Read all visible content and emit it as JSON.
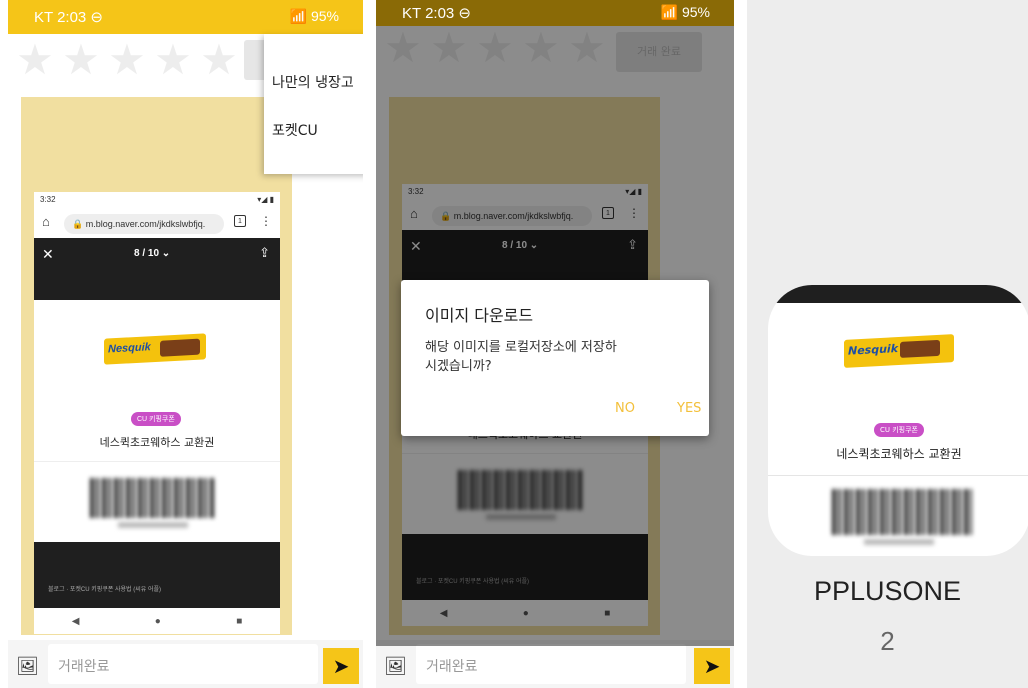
{
  "screen1": {
    "status": {
      "time": "KT 2:03 ⊖",
      "right": "📶 95%"
    },
    "stars": [
      "★",
      "★",
      "★",
      "★",
      "★"
    ],
    "menu": [
      "나만의 냉장고",
      "포켓CU"
    ],
    "phone": {
      "status_time": "3:32",
      "status_right": "▾◢ ▮",
      "url": "m.blog.naver.com/jkdkslwbfjq.",
      "tab_count": "1",
      "counter": "8 / 10 ⌄",
      "brand": "Nesquik",
      "badge": "CU 키핑쿠폰",
      "product": "네스퀵초코웨하스 교환권",
      "footer": "블로그 · 포켓CU 키핑쿠폰 사용법 (씨유 어플)"
    },
    "input_placeholder": "거래완료"
  },
  "screen2": {
    "status": {
      "time": "KT 2:03 ⊖",
      "right": "📶 95%"
    },
    "trade_button": "거래 완료",
    "phone": {
      "status_time": "3:32",
      "url": "m.blog.naver.com/jkdkslwbfjq.",
      "counter": "8 / 10 ⌄",
      "product": "네스퀵초코웨하스 교환권",
      "footer": "블로그 · 포켓CU 키핑쿠폰 사용법 (씨유 어플)"
    },
    "dialog": {
      "title": "이미지 다운로드",
      "message": "해당 이미지를 로컬저장소에 저장하시겠습니까?",
      "no": "NO",
      "yes": "YES"
    },
    "input_placeholder": "거래완료"
  },
  "screen3": {
    "brand": "Nesquik",
    "badge": "CU 키핑쿠폰",
    "product": "네스퀵초코웨하스 교환권",
    "user_name": "PPLUSONE",
    "count": "2"
  },
  "colors": {
    "accent": "#f5c518",
    "dialog_button": "#f3c03b",
    "chat_bg": "#f1dfa0"
  }
}
